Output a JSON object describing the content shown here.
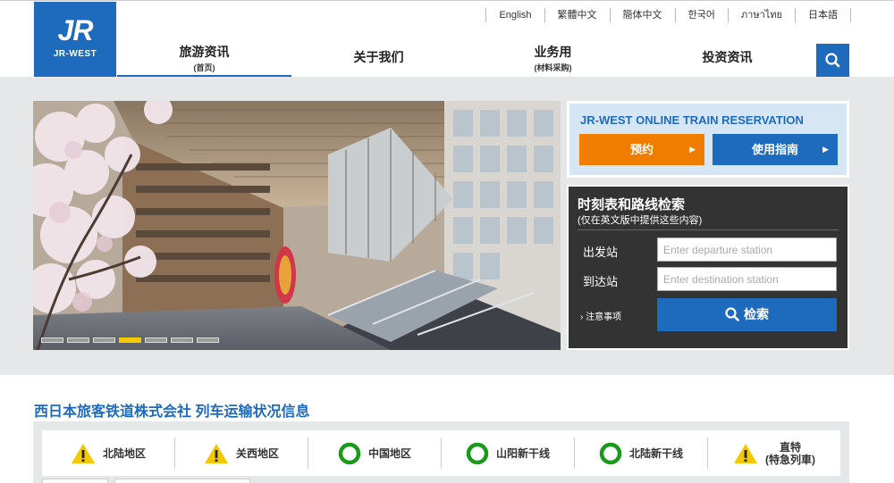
{
  "brand": {
    "logo_mark": "JR",
    "logo_text": "JR-WEST",
    "color": "#1e6bbd"
  },
  "languages": [
    "English",
    "繁體中文",
    "簡体中文",
    "한국어",
    "ภาษาไทย",
    "日本語"
  ],
  "nav": [
    {
      "label": "旅游资讯",
      "sub": "(首页)",
      "active": true
    },
    {
      "label": "关于我们",
      "sub": ""
    },
    {
      "label": "业务用",
      "sub": "(材料采购)"
    },
    {
      "label": "投资资讯",
      "sub": ""
    }
  ],
  "search_icon": "search-icon",
  "hero": {
    "slides": 7,
    "active_slide": 4,
    "active_color": "#f5c800"
  },
  "reservation": {
    "title": "JR-WEST ONLINE TRAIN RESERVATION",
    "book_label": "预约",
    "guide_label": "使用指南",
    "book_color": "#f07d00"
  },
  "timetable": {
    "title": "时刻表和路线检索",
    "subtitle": "(仅在英文版中提供这些内容)",
    "departure_label": "出发站",
    "departure_placeholder": "Enter departure station",
    "arrival_label": "到达站",
    "arrival_placeholder": "Enter destination station",
    "notes_label": "注意事项",
    "search_label": "检索"
  },
  "train_status": {
    "title": "西日本旅客铁道株式会社 列车运输状况信息",
    "regions": [
      {
        "label": "北陆地区",
        "sub": "",
        "status": "warning"
      },
      {
        "label": "关西地区",
        "sub": "",
        "status": "warning"
      },
      {
        "label": "中国地区",
        "sub": "",
        "status": "normal"
      },
      {
        "label": "山阳新干线",
        "sub": "",
        "status": "normal"
      },
      {
        "label": "北陆新干线",
        "sub": "",
        "status": "normal"
      },
      {
        "label": "直特",
        "sub": "(特急列車)",
        "status": "warning"
      }
    ],
    "warning_color": "#f5c800",
    "normal_color": "#1a9a1a"
  }
}
